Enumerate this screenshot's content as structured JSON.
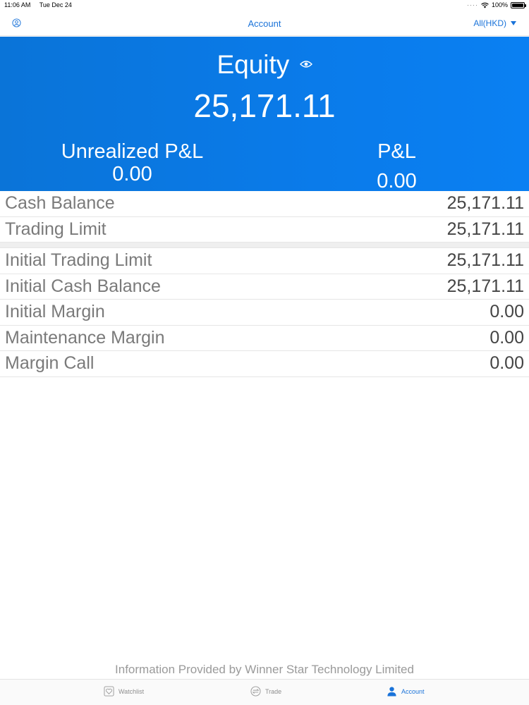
{
  "status_bar": {
    "time": "11:06 AM",
    "date": "Tue Dec 24",
    "battery": "100%"
  },
  "nav": {
    "title": "Account",
    "currency_selector": "All(HKD)"
  },
  "summary": {
    "equity_label": "Equity",
    "equity_value": "25,171.11",
    "unrealized_label": "Unrealized P&L",
    "unrealized_value": "0.00",
    "pl_label": "P&L",
    "pl_value": "0.00"
  },
  "rows_group1": [
    {
      "label": "Cash Balance",
      "value": "25,171.11"
    },
    {
      "label": "Trading Limit",
      "value": "25,171.11"
    }
  ],
  "rows_group2": [
    {
      "label": "Initial Trading Limit",
      "value": "25,171.11"
    },
    {
      "label": "Initial Cash Balance",
      "value": "25,171.11"
    },
    {
      "label": "Initial Margin",
      "value": "0.00"
    },
    {
      "label": "Maintenance Margin",
      "value": "0.00"
    },
    {
      "label": "Margin Call",
      "value": "0.00"
    }
  ],
  "footer": {
    "info": "Information Provided by Winner Star Technology Limited"
  },
  "tabs": [
    {
      "label": "Watchlist",
      "icon": "heart-icon",
      "active": false
    },
    {
      "label": "Trade",
      "icon": "swap-icon",
      "active": false
    },
    {
      "label": "Account",
      "icon": "person-icon",
      "active": true
    }
  ],
  "colors": {
    "accent": "#1a73d9",
    "header_bg": "#0a7bea"
  }
}
